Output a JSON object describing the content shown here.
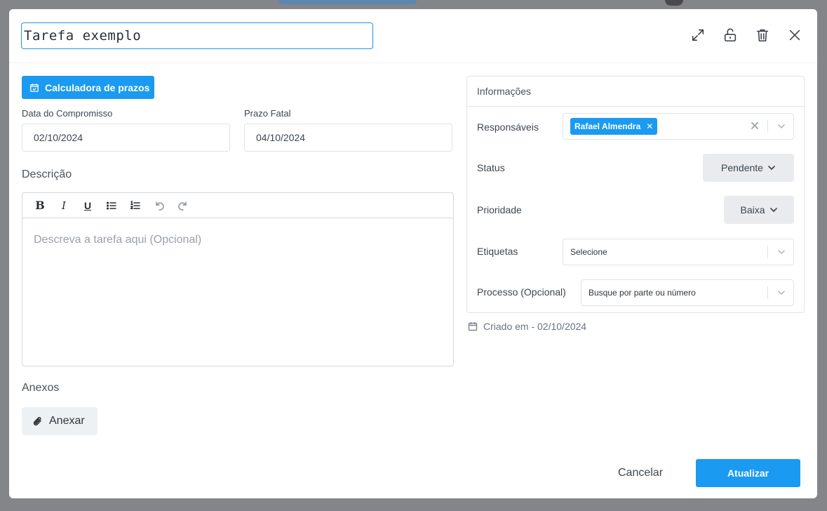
{
  "header": {
    "title_value": "Tarefa exemplo",
    "icons": [
      "expand-icon",
      "unlock-icon",
      "trash-icon",
      "close-icon"
    ]
  },
  "calculator_button": {
    "label": "Calculadora de prazos",
    "icon": "calendar-check-icon"
  },
  "dates": {
    "commitment": {
      "label": "Data do Compromisso",
      "value": "02/10/2024"
    },
    "deadline": {
      "label": "Prazo Fatal",
      "value": "04/10/2024"
    }
  },
  "description": {
    "title": "Descrição",
    "placeholder": "Descreva a tarefa aqui (Opcional)",
    "toolbar": [
      "bold",
      "italic",
      "underline",
      "bullet-list",
      "numbered-list",
      "undo",
      "redo"
    ]
  },
  "attachments": {
    "title": "Anexos",
    "button_label": "Anexar",
    "icon": "paperclip-icon"
  },
  "info": {
    "title": "Informações",
    "responsible": {
      "label": "Responsáveis",
      "chips": [
        "Rafael Almendra"
      ]
    },
    "status": {
      "label": "Status",
      "value": "Pendente"
    },
    "priority": {
      "label": "Prioridade",
      "value": "Baixa"
    },
    "tags": {
      "label": "Etiquetas",
      "placeholder": "Selecione"
    },
    "process": {
      "label": "Processo (Opcional)",
      "placeholder": "Busque por parte ou número"
    }
  },
  "created": {
    "text": "Criado em - 02/10/2024",
    "icon": "calendar-icon"
  },
  "footer": {
    "cancel_label": "Cancelar",
    "update_label": "Atualizar"
  },
  "colors": {
    "primary": "#1a9af0",
    "focus_border": "#1e96d8",
    "neutral_button": "#e9ebee"
  }
}
